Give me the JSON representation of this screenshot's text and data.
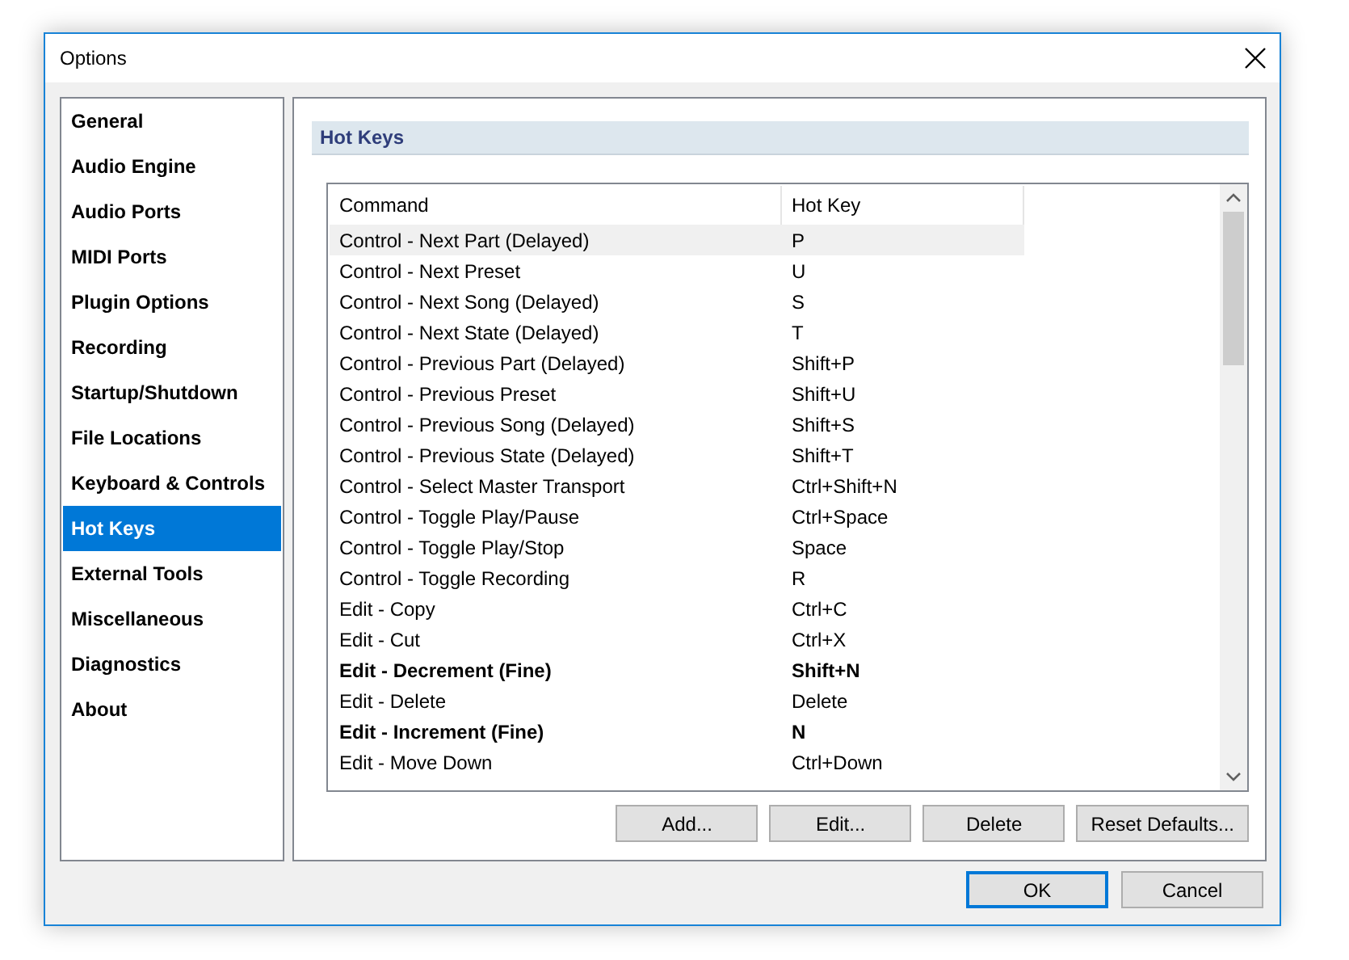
{
  "window": {
    "title": "Options"
  },
  "sidebar": {
    "items": [
      {
        "label": "General",
        "selected": false
      },
      {
        "label": "Audio Engine",
        "selected": false
      },
      {
        "label": "Audio Ports",
        "selected": false
      },
      {
        "label": "MIDI Ports",
        "selected": false
      },
      {
        "label": "Plugin Options",
        "selected": false
      },
      {
        "label": "Recording",
        "selected": false
      },
      {
        "label": "Startup/Shutdown",
        "selected": false
      },
      {
        "label": "File Locations",
        "selected": false
      },
      {
        "label": "Keyboard & Controls",
        "selected": false
      },
      {
        "label": "Hot Keys",
        "selected": true
      },
      {
        "label": "External Tools",
        "selected": false
      },
      {
        "label": "Miscellaneous",
        "selected": false
      },
      {
        "label": "Diagnostics",
        "selected": false
      },
      {
        "label": "About",
        "selected": false
      }
    ]
  },
  "section_title": "Hot Keys",
  "table": {
    "columns": [
      "Command",
      "Hot Key"
    ],
    "rows": [
      {
        "command": "Control - Next Part (Delayed)",
        "hot_key": "P",
        "selected": true,
        "modified": false
      },
      {
        "command": "Control - Next Preset",
        "hot_key": "U",
        "selected": false,
        "modified": false
      },
      {
        "command": "Control - Next Song (Delayed)",
        "hot_key": "S",
        "selected": false,
        "modified": false
      },
      {
        "command": "Control - Next State (Delayed)",
        "hot_key": "T",
        "selected": false,
        "modified": false
      },
      {
        "command": "Control - Previous Part (Delayed)",
        "hot_key": "Shift+P",
        "selected": false,
        "modified": false
      },
      {
        "command": "Control - Previous Preset",
        "hot_key": "Shift+U",
        "selected": false,
        "modified": false
      },
      {
        "command": "Control - Previous Song (Delayed)",
        "hot_key": "Shift+S",
        "selected": false,
        "modified": false
      },
      {
        "command": "Control - Previous State (Delayed)",
        "hot_key": "Shift+T",
        "selected": false,
        "modified": false
      },
      {
        "command": "Control - Select Master Transport",
        "hot_key": "Ctrl+Shift+N",
        "selected": false,
        "modified": false
      },
      {
        "command": "Control - Toggle Play/Pause",
        "hot_key": "Ctrl+Space",
        "selected": false,
        "modified": false
      },
      {
        "command": "Control - Toggle Play/Stop",
        "hot_key": "Space",
        "selected": false,
        "modified": false
      },
      {
        "command": "Control - Toggle Recording",
        "hot_key": "R",
        "selected": false,
        "modified": false
      },
      {
        "command": "Edit - Copy",
        "hot_key": "Ctrl+C",
        "selected": false,
        "modified": false
      },
      {
        "command": "Edit - Cut",
        "hot_key": "Ctrl+X",
        "selected": false,
        "modified": false
      },
      {
        "command": "Edit - Decrement (Fine)",
        "hot_key": "Shift+N",
        "selected": false,
        "modified": true
      },
      {
        "command": "Edit - Delete",
        "hot_key": "Delete",
        "selected": false,
        "modified": false
      },
      {
        "command": "Edit - Increment (Fine)",
        "hot_key": "N",
        "selected": false,
        "modified": true
      },
      {
        "command": "Edit - Move Down",
        "hot_key": "Ctrl+Down",
        "selected": false,
        "modified": false
      }
    ]
  },
  "table_buttons": [
    "Add...",
    "Edit...",
    "Delete",
    "Reset Defaults..."
  ],
  "dialog_buttons": [
    {
      "label": "OK",
      "default": true
    },
    {
      "label": "Cancel",
      "default": false
    }
  ]
}
